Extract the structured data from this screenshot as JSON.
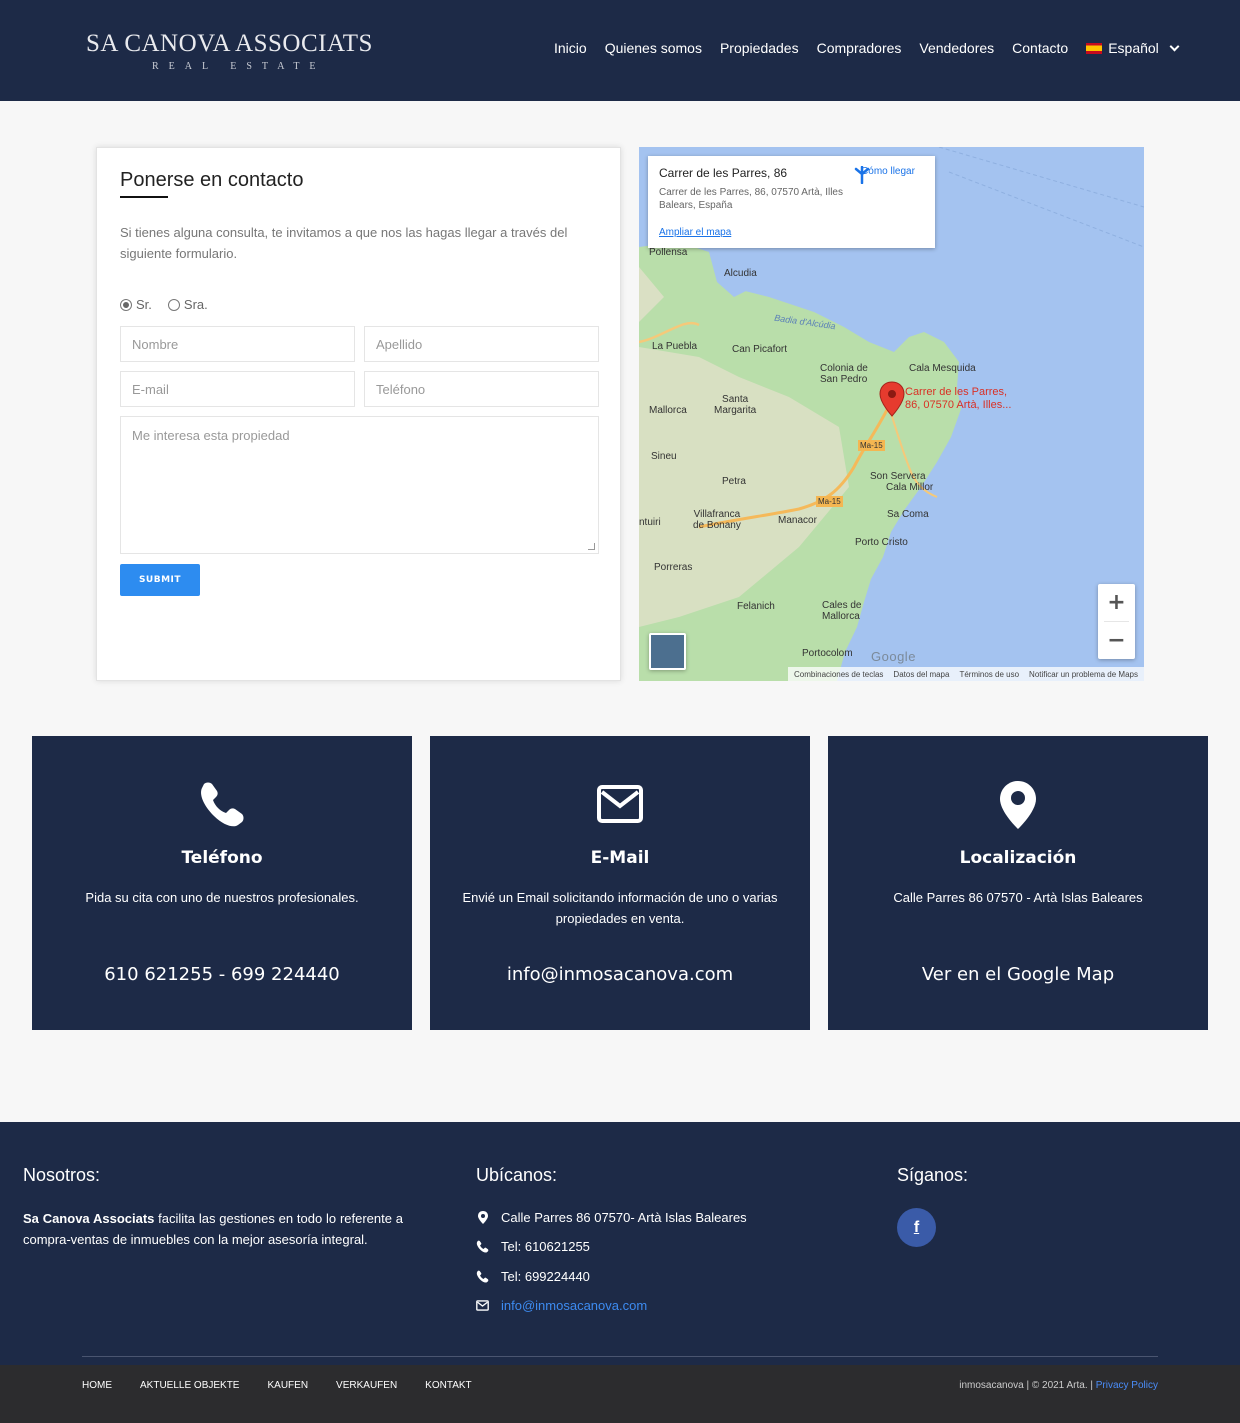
{
  "header": {
    "logo_main": "SA CANOVA ASSOCIATS",
    "logo_sub": "REAL ESTATE",
    "nav": [
      "Inicio",
      "Quienes somos",
      "Propiedades",
      "Compradores",
      "Vendedores",
      "Contacto"
    ],
    "language": "Español"
  },
  "contact_form": {
    "title": "Ponerse en contacto",
    "intro": "Si tienes alguna consulta, te invitamos a que nos las hagas llegar a través del siguiente  formulario.",
    "salutations": [
      "Sr.",
      "Sra."
    ],
    "selected_salutation": "Sr.",
    "placeholders": {
      "first_name": "Nombre",
      "last_name": "Apellido",
      "email": "E-mail",
      "phone": "Teléfono",
      "message": "Me interesa esta propiedad"
    },
    "submit_label": "SUBMIT"
  },
  "map": {
    "place_title": "Carrer de les Parres, 86",
    "place_address": "Carrer de les Parres, 86, 07570 Artà, Illes Balears, España",
    "enlarge_link": "Ampliar el mapa",
    "directions_label": "Cómo llegar",
    "marker_label_line1": "Carrer de les Parres,",
    "marker_label_line2": "86, 07570 Artà, Illes...",
    "places": {
      "pollensa": "Pollensa",
      "alcudia": "Alcudia",
      "bahia": "Badia d'Alcúdia",
      "la_puebla": "La Puebla",
      "can_picafort": "Can Picafort",
      "colonia_1": "Colonia de",
      "colonia_2": "San Pedro",
      "cala_mesquida": "Cala Mesquida",
      "santa_margarita_1": "Santa",
      "santa_margarita_2": "Margarita",
      "mallorca": "Mallorca",
      "sineu": "Sineu",
      "petra": "Petra",
      "son_servera": "Son Servera",
      "cala_millor": "Cala Millor",
      "villafranca_1": "Villafranca",
      "villafranca_2": "de Bonany",
      "manacor": "Manacor",
      "sa_coma": "Sa Coma",
      "ontuiri": "ntuiri",
      "porto_cristo": "Porto Cristo",
      "porreras": "Porreras",
      "felanich": "Felanich",
      "cales_1": "Cales de",
      "cales_2": "Mallorca",
      "portocolom": "Portocolom",
      "road_1": "Ma-15",
      "road_2": "Ma-15"
    },
    "google_logo": "Google",
    "attribution": [
      "Combinaciones de teclas",
      "Datos del mapa",
      "Términos de uso",
      "Notificar un problema de Maps"
    ],
    "zoom_in": "+",
    "zoom_out": "−"
  },
  "info_boxes": [
    {
      "title": "Teléfono",
      "text": "Pida su cita con uno de nuestros profesionales.",
      "main": "610 621255 - 699 224440",
      "icon": "phone-icon"
    },
    {
      "title": "E-Mail",
      "text": "Envié un Email solicitando información de uno o varias propiedades en venta.",
      "main": "info@inmosacanova.com",
      "icon": "envelope-icon"
    },
    {
      "title": "Localización",
      "text": "Calle Parres 86 07570 - Artà Islas Baleares",
      "main": "Ver en el Google Map",
      "icon": "map-pin-icon"
    }
  ],
  "footer": {
    "about_title": "Nosotros:",
    "about_brand": "Sa Canova Associats",
    "about_text": " facilita las gestiones en todo lo referente a compra-ventas de inmuebles con la mejor asesoría integral.",
    "locate_title": "Ubícanos:",
    "address": "Calle Parres 86 07570- Artà Islas Baleares",
    "tel1": "Tel: 610621255",
    "tel2": "Tel: 699224440",
    "email": "info@inmosacanova.com",
    "follow_title": "Síganos:",
    "facebook": "f"
  },
  "bottom_bar": {
    "links": [
      "HOME",
      "AKTUELLE OBJEKTE",
      "KAUFEN",
      "VERKAUFEN",
      "KONTAKT"
    ],
    "copyright": "inmosacanova | © 2021 Arta. | ",
    "privacy": "Privacy Policy"
  },
  "colors": {
    "navy": "#1d2a47",
    "accent": "#2d8cf0",
    "facebook": "#3a5ba8",
    "bottom_bar": "#2c2c2e"
  }
}
